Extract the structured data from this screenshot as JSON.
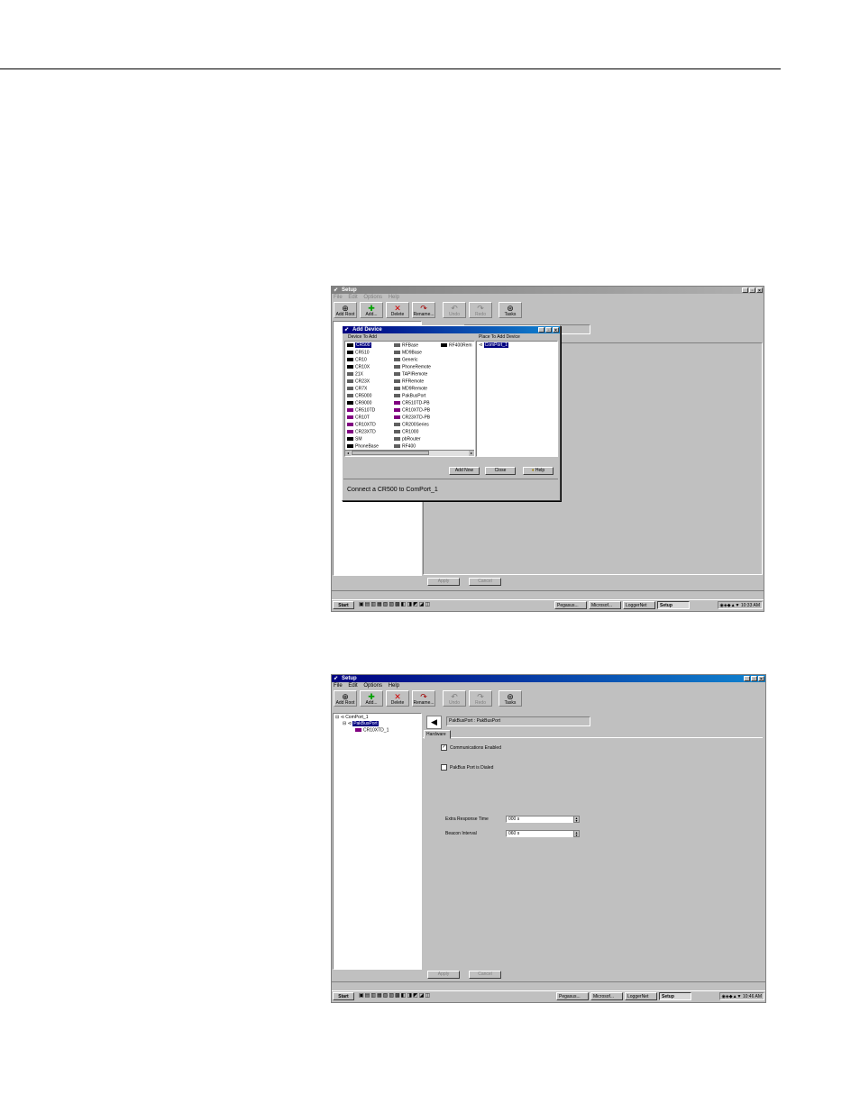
{
  "app": {
    "title": "Setup",
    "menu": [
      "File",
      "Edit",
      "Options",
      "Help"
    ],
    "toolbar": [
      {
        "label": "Add Root",
        "icon": "⊕"
      },
      {
        "label": "Add...",
        "icon": "✚"
      },
      {
        "label": "Delete",
        "icon": "✕"
      },
      {
        "label": "Rename...",
        "icon": "↷"
      },
      {
        "label": "Undo",
        "icon": "↶"
      },
      {
        "label": "Redo",
        "icon": "↷"
      },
      {
        "label": "Tasks",
        "icon": "⊛"
      }
    ],
    "apply_label": "Apply",
    "cancel_label": "Cancel"
  },
  "taskbar": {
    "start": "Start",
    "tasks": [
      "Pegasus...",
      "Microsof...",
      "LoggerNet",
      "Setup"
    ],
    "clock1": "10:33 AM",
    "clock2": "10:46 AM"
  },
  "dialog": {
    "title": "Add Device",
    "col1_header": "Device To Add",
    "col2_header": "Place To Add Device",
    "devices_col1": [
      "CR500",
      "CR510",
      "CR10",
      "CR10X",
      "21X",
      "CR23X",
      "CR7X",
      "CR5000",
      "CR9000",
      "CR510TD",
      "CR10T",
      "CR10XTD",
      "CR23XTD",
      "SM",
      "PhoneBase"
    ],
    "devices_col2": [
      "RFBase",
      "MD9Base",
      "Generic",
      "PhoneRemote",
      "TAPIRemote",
      "RFRemote",
      "MD9Remote",
      "PakBusPort",
      "CR510TD-PB",
      "CR10XTD-PB",
      "CR23XTD-PB",
      "CR200Series",
      "CR1000",
      "pbRouter",
      "RF400"
    ],
    "devices_col3": [
      "RF400Rem"
    ],
    "place_item": "ComPort_1",
    "add_now": "Add Now",
    "close": "Close",
    "help": "Help",
    "status": "Connect a CR500 to ComPort_1"
  },
  "screen2": {
    "tree": [
      "ComPort_1",
      "PakBusPort",
      "CR10XTD_1"
    ],
    "header_text": "PakBusPort : PakBusPort",
    "tab": "Hardware",
    "comm_enabled": "Communications Enabled",
    "dialed": "PakBus Port is Dialed",
    "extra_label": "Extra Response Time",
    "extra_value": "000 s",
    "beacon_label": "Beacon Interval",
    "beacon_value": "060 s"
  }
}
